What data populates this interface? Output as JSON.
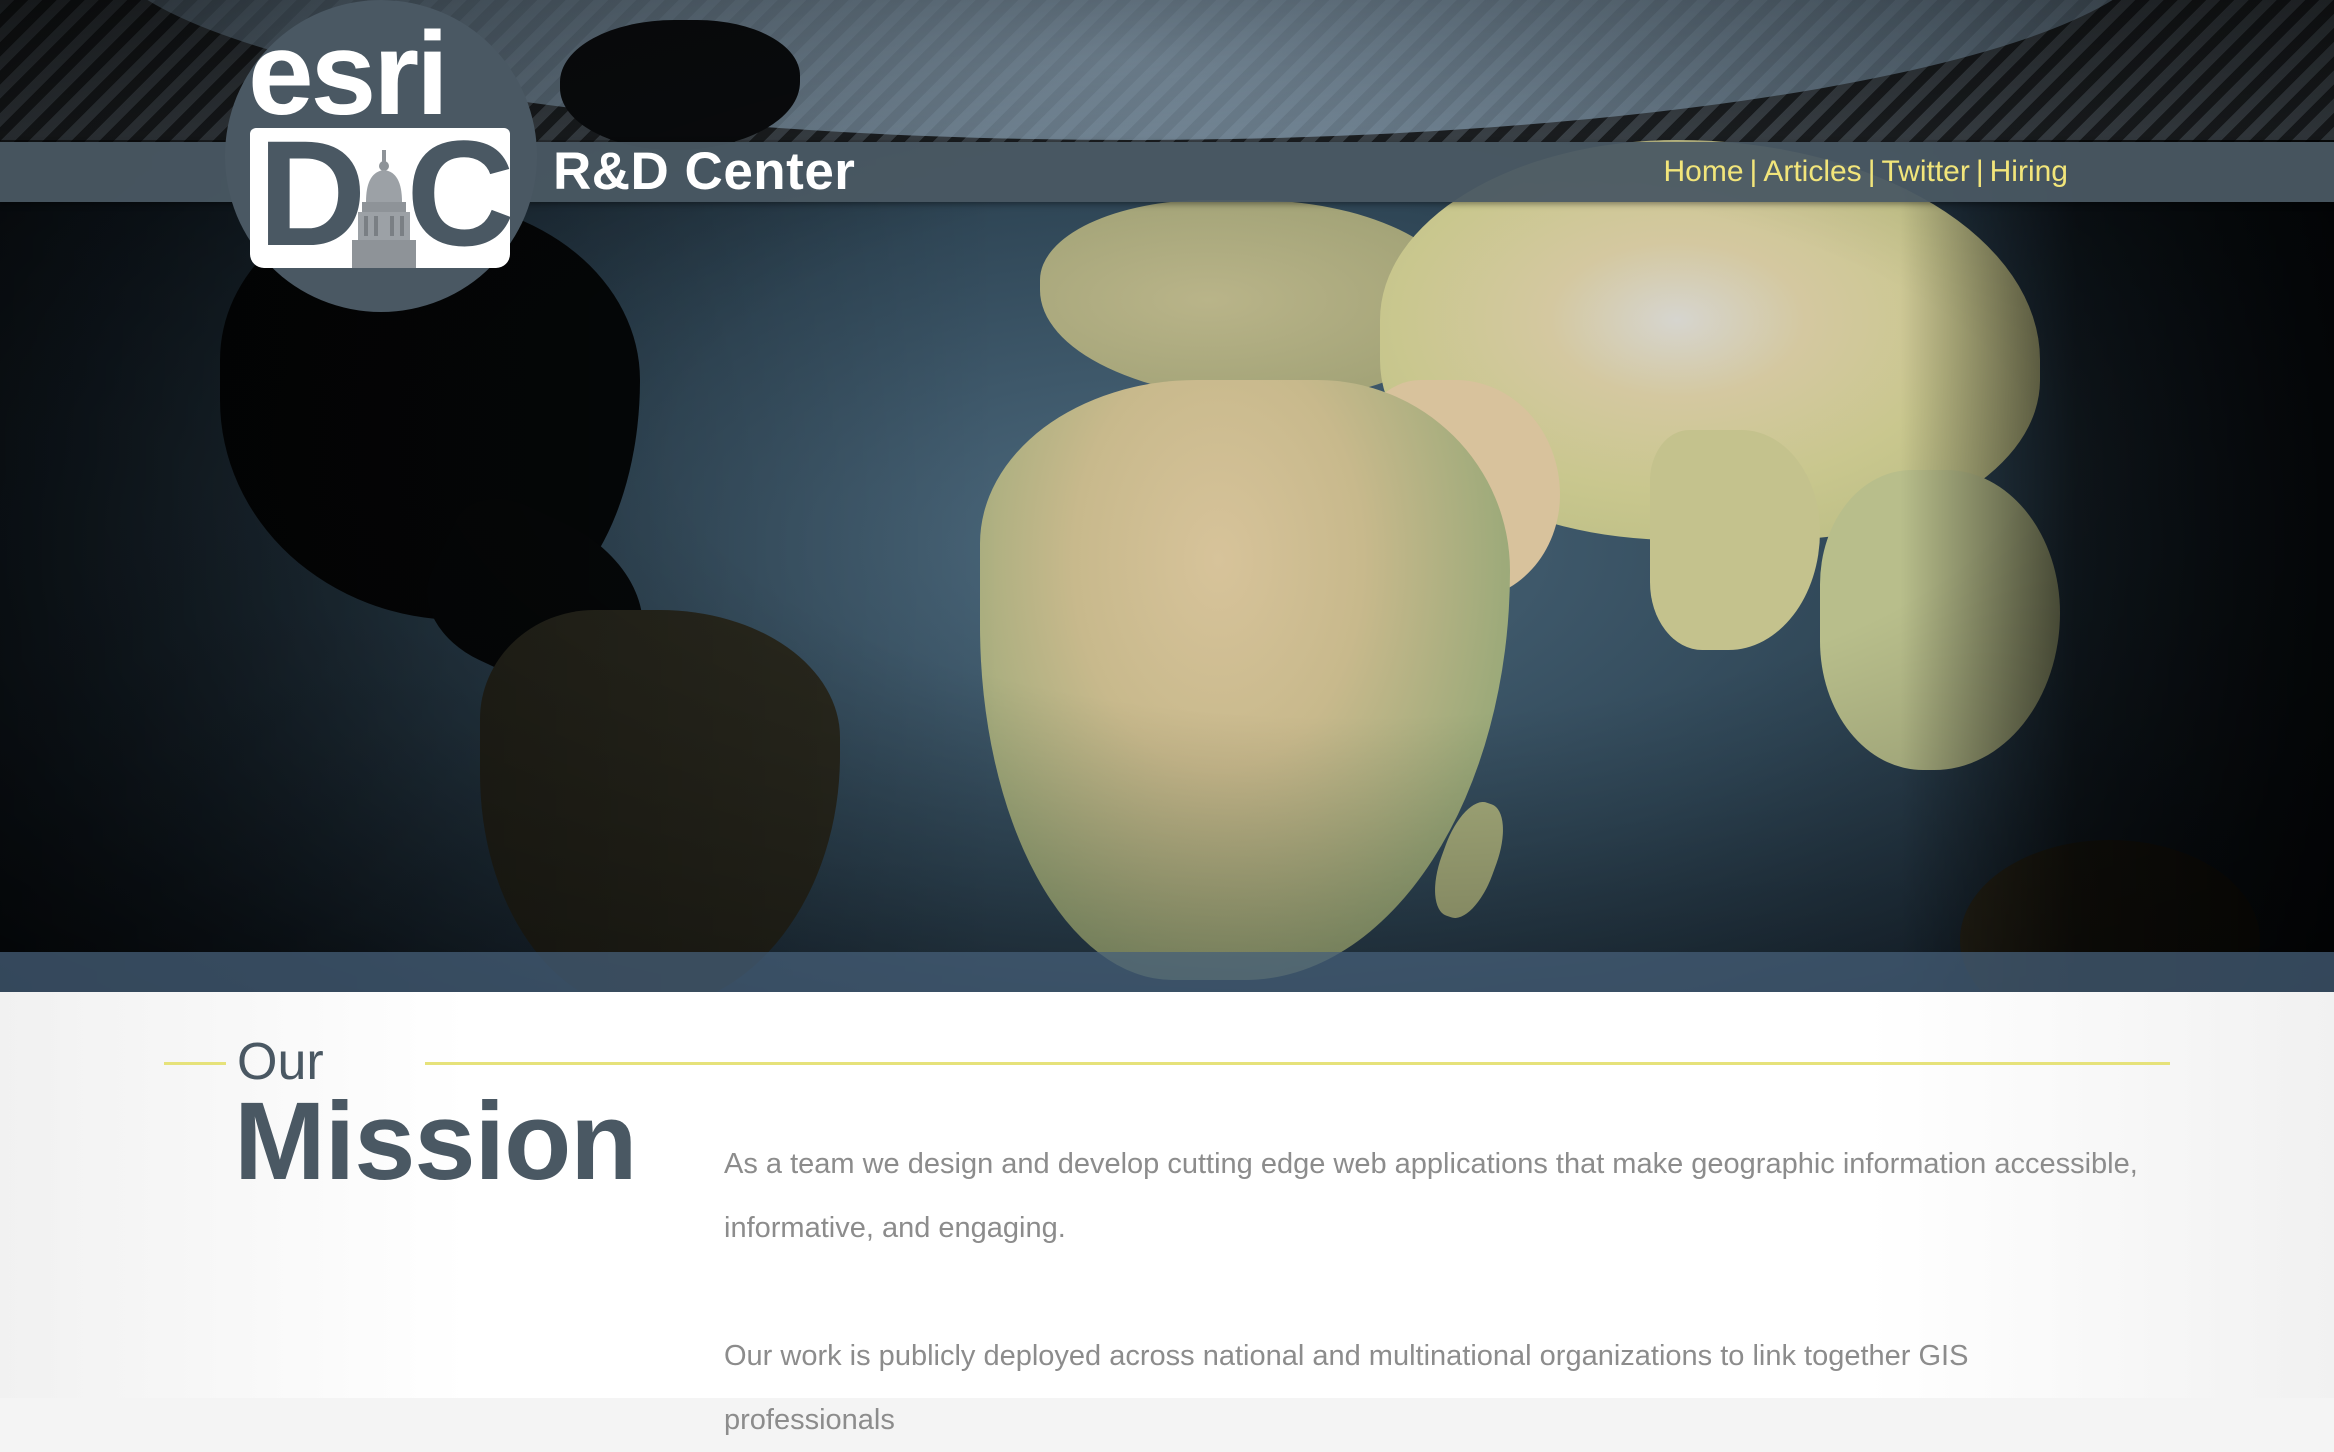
{
  "logo": {
    "top_text": "esri",
    "bottom_text": "DC"
  },
  "header": {
    "site_title": "R&D Center",
    "nav": [
      {
        "label": "Home"
      },
      {
        "label": "Articles"
      },
      {
        "label": "Twitter"
      },
      {
        "label": "Hiring"
      }
    ],
    "nav_separator": "|"
  },
  "mission": {
    "heading_small": "Our",
    "heading_big": "Mission",
    "paragraphs": [
      "As a team we design and develop cutting edge web applications that make geographic information accessible, informative, and engaging.",
      "Our work is publicly deployed across national and multinational organizations to link together GIS professionals"
    ]
  },
  "colors": {
    "nav_link": "#f2e57a",
    "nav_bar": "#4a5863",
    "heading": "#4a5863",
    "body_text": "#8c8c8c",
    "accent_rule": "#e6e27a"
  },
  "icons": {
    "logo_dome": "capitol-dome-icon"
  }
}
